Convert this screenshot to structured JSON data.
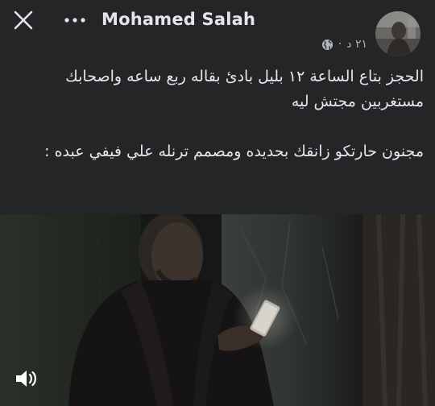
{
  "header": {
    "close_icon": "close-icon",
    "more_icon": "more-horizontal-icon",
    "author_name": "Mohamed Salah"
  },
  "meta": {
    "time": "٢١ د",
    "separator": "·",
    "privacy_icon": "globe-icon"
  },
  "post": {
    "paragraph_1": "الحجز بتاع الساعة ١٢ بليل بادئ بقاله ربع ساعه واصحابك مستغربين مجتش ليه",
    "paragraph_2": "مجنون حارتكو زانقك بحديده ومصمم ترنله علي فيفي عبده :"
  },
  "media": {
    "type": "video",
    "volume_icon": "volume-icon"
  },
  "colors": {
    "background": "#242526",
    "text_primary": "#e4e6eb",
    "text_secondary": "#b0b3b8"
  }
}
